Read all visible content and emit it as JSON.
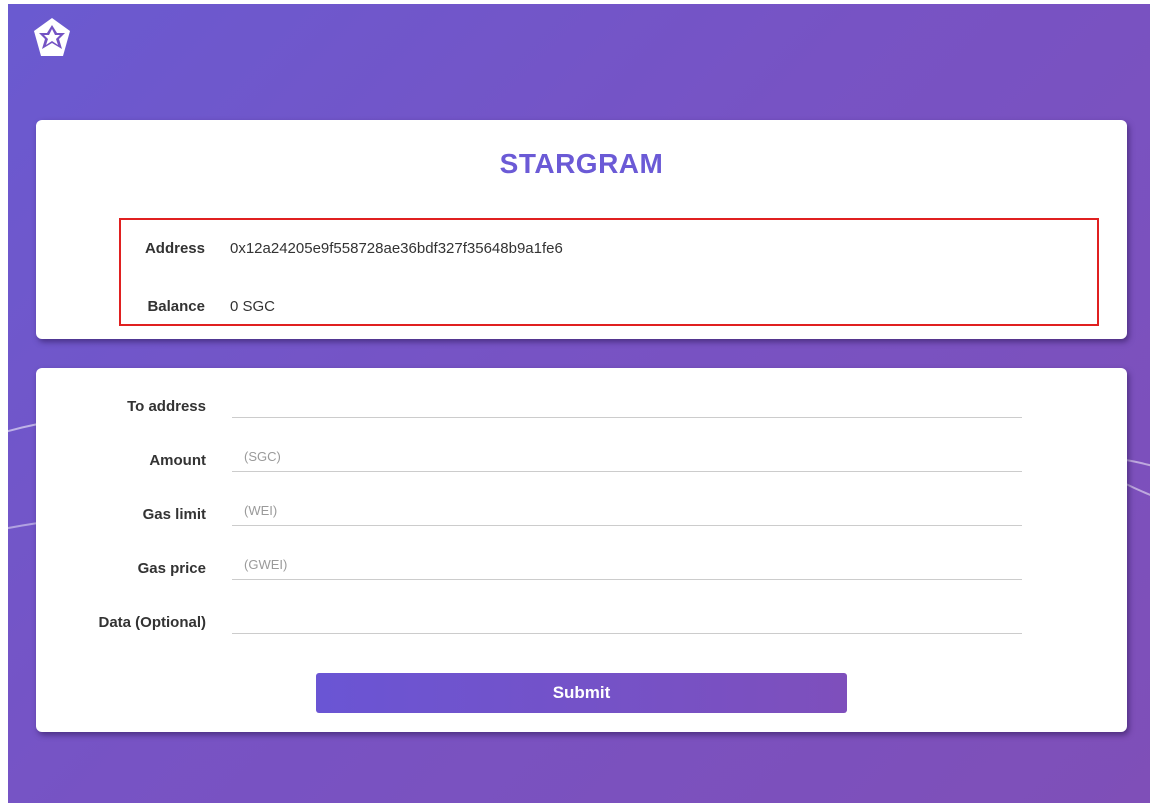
{
  "app": {
    "title": "STARGRAM",
    "logo_icon": "star-pentagon-logo-icon"
  },
  "wallet": {
    "address_label": "Address",
    "address_value": "0x12a24205e9f558728ae36bdf327f35648b9a1fe6",
    "balance_label": "Balance",
    "balance_value": "0 SGC"
  },
  "form": {
    "to_address": {
      "label": "To address",
      "value": "",
      "placeholder": ""
    },
    "amount": {
      "label": "Amount",
      "value": "",
      "placeholder": "(SGC)"
    },
    "gas_limit": {
      "label": "Gas limit",
      "value": "",
      "placeholder": "(WEI)"
    },
    "gas_price": {
      "label": "Gas price",
      "value": "",
      "placeholder": "(GWEI)"
    },
    "data": {
      "label": "Data (Optional)",
      "value": "",
      "placeholder": ""
    },
    "submit_label": "Submit"
  },
  "colors": {
    "accent": "#6b5ad6",
    "background_start": "#6a5ad0",
    "background_end": "#7f4fb8",
    "highlight_border": "#e02020"
  }
}
